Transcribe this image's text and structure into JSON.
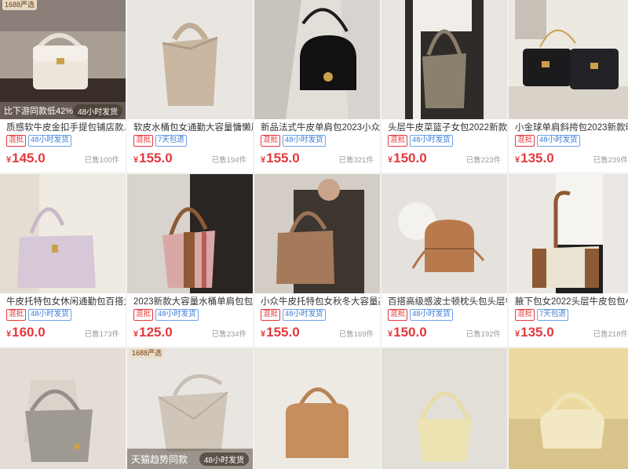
{
  "badge_1688": "1688严选",
  "products": [
    {
      "title": "质感软牛皮金扣手提包铺店款...",
      "tags": [
        "混批",
        "48小时发货"
      ],
      "price": "145.0",
      "sold": "已售100件",
      "promo_left": "比下游同款低42%",
      "promo_right": "48小时发货",
      "badge": true
    },
    {
      "title": "软皮水桶包女通勤大容量慵懒风...",
      "tags": [
        "混批",
        "7天包退"
      ],
      "price": "155.0",
      "sold": "已售194件"
    },
    {
      "title": "新品法式牛皮单肩包2023小众...",
      "tags": [
        "混批",
        "48小时发货"
      ],
      "price": "155.0",
      "sold": "已售321件"
    },
    {
      "title": "头层牛皮菜篮子女包2022新款...",
      "tags": [
        "混批",
        "48小时发货"
      ],
      "price": "150.0",
      "sold": "已售223件"
    },
    {
      "title": "小金球单肩斜挎包2023新款时...",
      "tags": [
        "混批",
        "48小时发货"
      ],
      "price": "135.0",
      "sold": "已售239件"
    },
    {
      "title": "牛皮托特包女休闲通勤包百搭大...",
      "tags": [
        "混批",
        "48小时发货"
      ],
      "price": "160.0",
      "sold": "已售173件"
    },
    {
      "title": "2023新款大容量水桶单肩包包...",
      "tags": [
        "混批",
        "48小时发货"
      ],
      "price": "125.0",
      "sold": "已售234件"
    },
    {
      "title": "小众牛皮托特包女秋冬大容量高...",
      "tags": [
        "混批",
        "48小时发货"
      ],
      "price": "155.0",
      "sold": "已售169件"
    },
    {
      "title": "百搭高级感波士顿枕头包头层牛...",
      "tags": [
        "混批",
        "48小时发货"
      ],
      "price": "150.0",
      "sold": "已售192件"
    },
    {
      "title": "腋下包女2022头层牛皮包包小...",
      "tags": [
        "混批",
        "7天包退"
      ],
      "price": "135.0",
      "sold": "已售218件"
    }
  ],
  "row3": [
    {},
    {
      "badge": true,
      "promo_left": "天猫趋势同款",
      "promo_right": "48小时发货"
    },
    {},
    {},
    {}
  ],
  "currency": "¥",
  "colors": {
    "price": "#e4393c",
    "tag_red": "#e4393c",
    "tag_blue": "#3a7bd5"
  }
}
